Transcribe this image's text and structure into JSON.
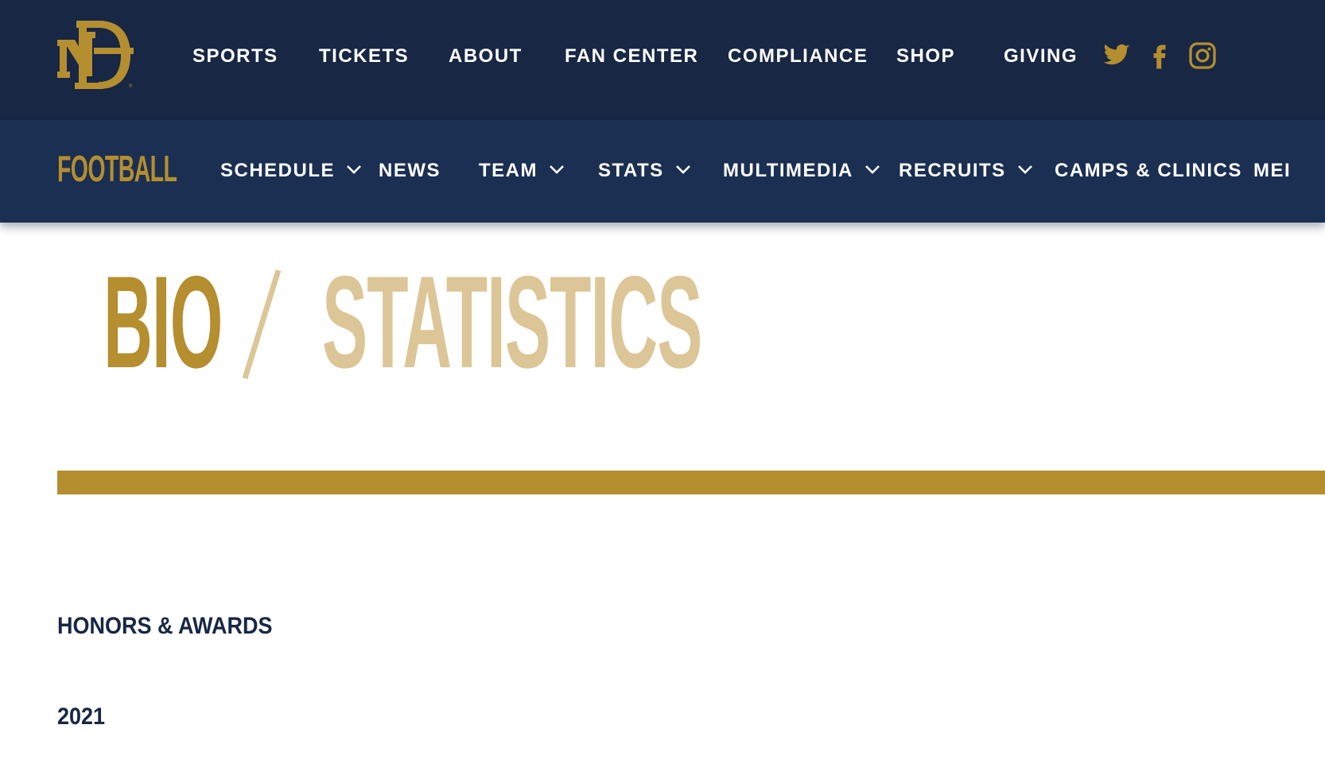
{
  "brand": {
    "logo_icon": "nd-monogram-logo",
    "navy": "#172744",
    "navy_secondary": "#1b2f52",
    "gold": "#b48e2f",
    "light_gold": "#dcc697"
  },
  "top_nav": {
    "items": [
      {
        "label": "SPORTS"
      },
      {
        "label": "TICKETS"
      },
      {
        "label": "ABOUT"
      },
      {
        "label": "FAN CENTER"
      },
      {
        "label": "COMPLIANCE"
      },
      {
        "label": "SHOP"
      },
      {
        "label": "GIVING"
      }
    ],
    "social": [
      {
        "icon": "twitter-icon"
      },
      {
        "icon": "facebook-icon"
      },
      {
        "icon": "instagram-icon"
      }
    ]
  },
  "sport_nav": {
    "title": "FOOTBALL",
    "items": [
      {
        "label": "SCHEDULE",
        "has_dropdown": true
      },
      {
        "label": "NEWS",
        "has_dropdown": false
      },
      {
        "label": "TEAM",
        "has_dropdown": true
      },
      {
        "label": "STATS",
        "has_dropdown": true
      },
      {
        "label": "MULTIMEDIA",
        "has_dropdown": true
      },
      {
        "label": "RECRUITS",
        "has_dropdown": true
      },
      {
        "label": "CAMPS & CLINICS",
        "has_dropdown": false
      },
      {
        "label": "MEI",
        "has_dropdown": false
      }
    ]
  },
  "page_tabs": {
    "active": "BIO",
    "separator": "/",
    "bio_label": "BIO",
    "stats_label": "STATISTICS"
  },
  "content": {
    "section_heading": "HONORS & AWARDS",
    "year_heading": "2021"
  }
}
